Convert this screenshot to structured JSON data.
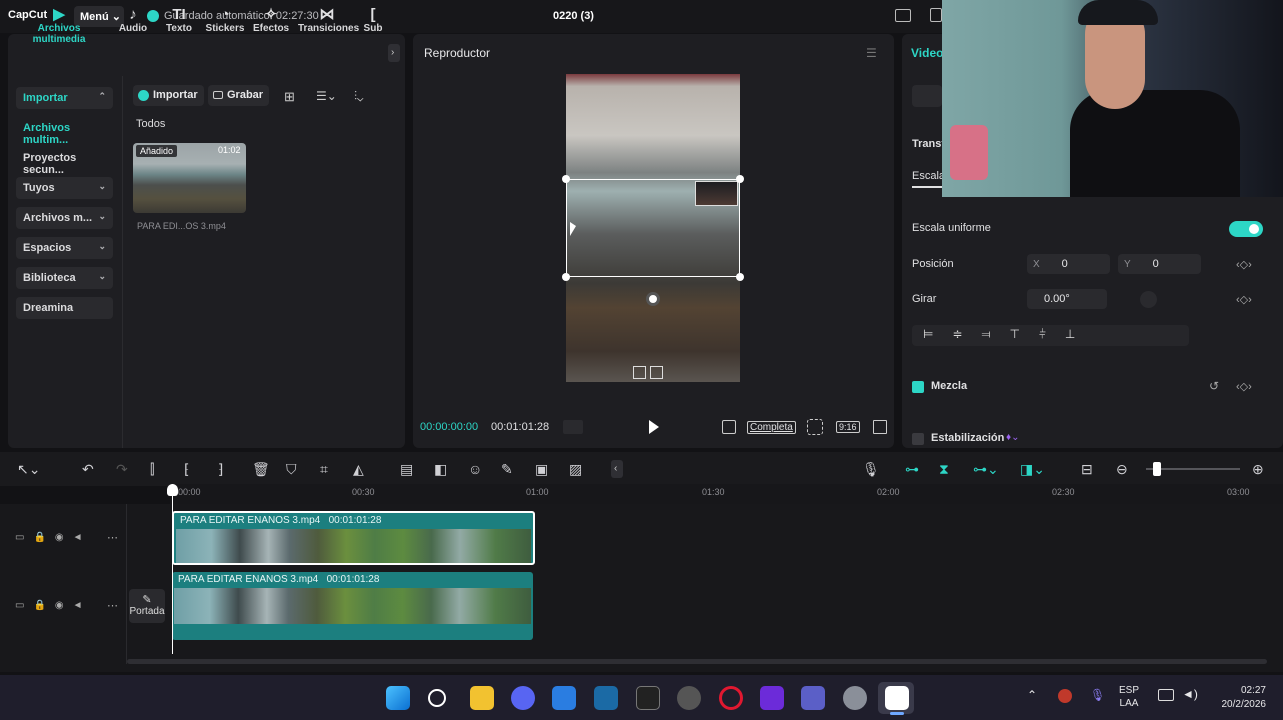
{
  "app": {
    "logo": "CapCut",
    "menu_label": "Menú ⌄",
    "autosave": "Guardado automático: 02:27:30",
    "project_title": "0220 (3)"
  },
  "media_tabs": [
    {
      "label": "Archivos multimedia",
      "icon": "media-icon",
      "glyph": "▶"
    },
    {
      "label": "Audio",
      "icon": "audio-icon",
      "glyph": "♪"
    },
    {
      "label": "Texto",
      "icon": "text-icon",
      "glyph": "TI"
    },
    {
      "label": "Stickers",
      "icon": "sticker-icon",
      "glyph": "◔"
    },
    {
      "label": "Efectos",
      "icon": "effects-icon",
      "glyph": "✧"
    },
    {
      "label": "Transiciones",
      "icon": "transitions-icon",
      "glyph": "⋈"
    },
    {
      "label": "Sub",
      "icon": "subtitles-icon",
      "glyph": "["
    }
  ],
  "media_sidebar": [
    {
      "label": "Importar",
      "caret": "⌃"
    },
    {
      "label": "Archivos multim..."
    },
    {
      "label": "Proyectos secun..."
    },
    {
      "label": "Tuyos",
      "caret": "⌄"
    },
    {
      "label": "Archivos m...",
      "caret": "⌄"
    },
    {
      "label": "Espacios",
      "caret": "⌄"
    },
    {
      "label": "Biblioteca",
      "caret": "⌄"
    },
    {
      "label": "Dreamina"
    }
  ],
  "media_toolbar": {
    "import_label": "Importar",
    "record_label": "Grabar"
  },
  "media_filter": "Todos",
  "media_item": {
    "badge": "Añadido",
    "duration": "01:02",
    "filename": "PARA EDI...OS 3.mp4"
  },
  "player": {
    "title": "Reproductor",
    "current_time": "00:00:00:00",
    "total_time": "00:01:01:28",
    "fit_label": "Completa",
    "ratio_label": "9:16"
  },
  "properties": {
    "tab_video": "Video",
    "section_transform": "Transf",
    "scale_label": "Escala",
    "uniform_scale_label": "Escala uniforme",
    "uniform_scale_on": true,
    "position_label": "Posición",
    "x_axis": "X",
    "x_value": "0",
    "y_axis": "Y",
    "y_value": "0",
    "rotate_label": "Girar",
    "rotate_value": "0.00°",
    "blend_label": "Mezcla",
    "blend_checked": true,
    "stabilize_label": "Estabilización"
  },
  "ruler_labels": [
    "00:00",
    "00:30",
    "01:00",
    "01:30",
    "02:00",
    "02:30",
    "03:00"
  ],
  "tracks": [
    {
      "clip_name": "PARA EDITAR ENANOS 3.mp4",
      "clip_duration": "00:01:01:28",
      "selected": true
    },
    {
      "clip_name": "PARA EDITAR ENANOS 3.mp4",
      "clip_duration": "00:01:01:28",
      "selected": false,
      "cover_label": "Portada"
    }
  ],
  "taskbar": {
    "language": "ESP",
    "layout": "LAA",
    "time": "02:27",
    "date": "20/2/2026",
    "apps": [
      "windows-start-icon",
      "search-icon",
      "file-explorer-icon",
      "discord-icon",
      "store-icon",
      "steam-icon",
      "epic-games-icon",
      "chrome-icon",
      "opera-icon",
      "nzxt-icon",
      "teams-icon",
      "settings-icon",
      "capcut-icon"
    ]
  },
  "colors": {
    "accent": "#2dd6c6",
    "clip": "#1c7f7f",
    "background": "#121215"
  }
}
